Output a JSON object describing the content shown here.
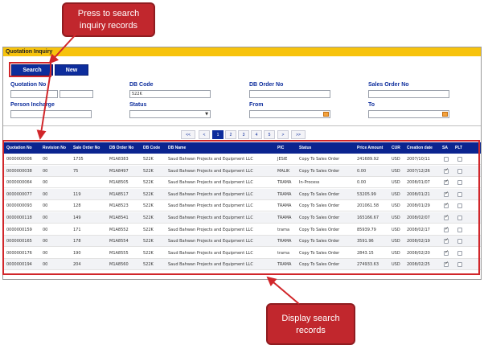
{
  "panel": {
    "title": "Quotation Inquiry"
  },
  "buttons": {
    "search": "Search",
    "new": "New"
  },
  "form": {
    "quotation_no": "Quotation No",
    "db_code": "DB Code",
    "db_code_value": "522K",
    "db_order_no": "DB Order No",
    "sales_order_no": "Sales Order No",
    "person_incharge": "Person Incharge",
    "status": "Status",
    "from": "From",
    "to": "To"
  },
  "pagination": {
    "first": "<<",
    "prev": "<",
    "pages": [
      "1",
      "2",
      "3",
      "4",
      "5"
    ],
    "next": ">",
    "last": ">>",
    "current": "1"
  },
  "table": {
    "headers": [
      "Quotation No",
      "Revision No",
      "Sale Order No",
      "DB Order No",
      "DB Code",
      "DB Name",
      "PIC",
      "Status",
      "Price Amount",
      "CUR",
      "Creation date",
      "SA",
      "PLT"
    ],
    "rows": [
      [
        "0000000006",
        "00",
        "1735",
        "M1A8383",
        "522K",
        "Saud Bahwan Projects and Equipment LLC",
        "JESIE",
        "Copy To Sales Order",
        "241689.92",
        "USD",
        "2007/10/11",
        false,
        false
      ],
      [
        "0000000038",
        "00",
        "75",
        "M1A8497",
        "522K",
        "Saud Bahwan Projects and Equipment LLC",
        "MALIK",
        "Copy To Sales Order",
        "0.00",
        "USD",
        "2007/12/26",
        true,
        false
      ],
      [
        "0000000064",
        "00",
        "",
        "M1A8505",
        "522K",
        "Saud Bahwan Projects and Equipment LLC",
        "TRAMA",
        "In-Process",
        "0.00",
        "USD",
        "2008/01/07",
        true,
        false
      ],
      [
        "0000000077",
        "00",
        "119",
        "M1A8517",
        "522K",
        "Saud Bahwan Projects and Equipment LLC",
        "TRAMA",
        "Copy To Sales Order",
        "53205.99",
        "USD",
        "2008/01/21",
        true,
        false
      ],
      [
        "0000000093",
        "00",
        "128",
        "M1A8523",
        "522K",
        "Saud Bahwan Projects and Equipment LLC",
        "TRAMA",
        "Copy To Sales Order",
        "201061.58",
        "USD",
        "2008/01/29",
        true,
        false
      ],
      [
        "0000000118",
        "00",
        "149",
        "M1A8541",
        "522K",
        "Saud Bahwan Projects and Equipment LLC",
        "TRAMA",
        "Copy To Sales Order",
        "165166.67",
        "USD",
        "2008/02/07",
        true,
        false
      ],
      [
        "0000000159",
        "00",
        "171",
        "M1A8552",
        "522K",
        "Saud Bahwan Projects and Equipment LLC",
        "trama",
        "Copy To Sales Order",
        "85939.79",
        "USD",
        "2008/02/17",
        true,
        false
      ],
      [
        "0000000165",
        "00",
        "178",
        "M1A8554",
        "522K",
        "Saud Bahwan Projects and Equipment LLC",
        "TRAMA",
        "Copy To Sales Order",
        "3591.96",
        "USD",
        "2008/02/19",
        true,
        false
      ],
      [
        "0000000176",
        "00",
        "190",
        "M1A8555",
        "522K",
        "Saud Bahwan Projects and Equipment LLC",
        "trama",
        "Copy To Sales Order",
        "2843.15",
        "USD",
        "2008/02/20",
        true,
        false
      ],
      [
        "0000000194",
        "00",
        "204",
        "M1A8560",
        "522K",
        "Saud Bahwan Projects and Equipment LLC",
        "TRAMA",
        "Copy To Sales Order",
        "274933.63",
        "USD",
        "2008/02/25",
        true,
        false
      ]
    ]
  },
  "callouts": {
    "top": [
      "Press to search",
      "inquiry records"
    ],
    "bottom": [
      "Display search",
      "records"
    ]
  },
  "colors": {
    "header_yellow": "#f7c30d",
    "nav_blue": "#0d2d9c",
    "callout_red": "#c1272d"
  }
}
